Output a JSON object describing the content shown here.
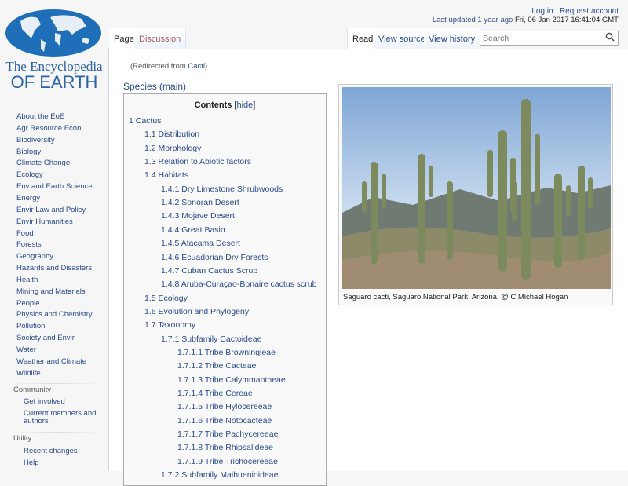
{
  "logo": {
    "line1": "The Encyclopedia",
    "line2": "OF EARTH"
  },
  "header": {
    "login": "Log in",
    "request_account": "Request account",
    "last_updated_label": "Last updated",
    "last_updated_rel": "1 year ago",
    "last_updated_date": "Fri, 06 Jan 2017 16:41:04 GMT"
  },
  "tabs": {
    "page": "Page",
    "discussion": "Discussion",
    "read": "Read",
    "view_source": "View source",
    "view_history": "View history"
  },
  "search": {
    "placeholder": "Search",
    "icon": "search-icon"
  },
  "sidebar": {
    "items": [
      "About the EoE",
      "Agr Resource Econ",
      "Biodiversity",
      "Biology",
      "Climate Change",
      "Ecology",
      "Env and Earth Science",
      "Energy",
      "Envir Law and Policy",
      "Envir Humanities",
      "Food",
      "Forests",
      "Geography",
      "Hazards and Disasters",
      "Health",
      "Mining and Materials",
      "People",
      "Physics and Chemistry",
      "Pollution",
      "Society and Envir",
      "Water",
      "Weather and Climate",
      "Wildlife"
    ],
    "community": {
      "heading": "Community",
      "items": [
        "Get involved",
        "Current members and",
        "authors"
      ]
    },
    "utility": {
      "heading": "Utility",
      "items": [
        "Recent changes",
        "Help"
      ]
    }
  },
  "main": {
    "redirect_prefix": "(Redirected from ",
    "redirect_link": "Cacti",
    "redirect_suffix": ")",
    "heading": "Species (main)"
  },
  "toc": {
    "title": "Contents",
    "hide_open": "[",
    "hide": "hide",
    "hide_close": "]",
    "items": [
      {
        "level": 1,
        "text": "1 Cactus"
      },
      {
        "level": 2,
        "text": "1.1 Distribution"
      },
      {
        "level": 2,
        "text": "1.2 Morphology"
      },
      {
        "level": 2,
        "text": "1.3 Relation to Abiotic factors"
      },
      {
        "level": 2,
        "text": "1.4 Habitats"
      },
      {
        "level": 3,
        "text": "1.4.1 Dry Limestone Shrubwoods"
      },
      {
        "level": 3,
        "text": "1.4.2 Sonoran Desert"
      },
      {
        "level": 3,
        "text": "1.4.3 Mojave Desert"
      },
      {
        "level": 3,
        "text": "1.4.4 Great Basin"
      },
      {
        "level": 3,
        "text": "1.4.5 Atacama Desert"
      },
      {
        "level": 3,
        "text": "1.4.6 Ecuadorian Dry Forests"
      },
      {
        "level": 3,
        "text": "1.4.7 Cuban Cactus Scrub"
      },
      {
        "level": 3,
        "text": "1.4.8 Aruba-Curaçao-Bonaire cactus scrub"
      },
      {
        "level": 2,
        "text": "1.5 Ecology"
      },
      {
        "level": 2,
        "text": "1.6 Evolution and Phylogeny"
      },
      {
        "level": 2,
        "text": "1.7 Taxonomy"
      },
      {
        "level": 3,
        "text": "1.7.1 Subfamily Cactoideae"
      },
      {
        "level": 4,
        "text": "1.7.1.1 Tribe Browningieae"
      },
      {
        "level": 4,
        "text": "1.7.1.2 Tribe Cacteae"
      },
      {
        "level": 4,
        "text": "1.7.1.3 Tribe Calymmantheae"
      },
      {
        "level": 4,
        "text": "1.7.1.4 Tribe Cereae"
      },
      {
        "level": 4,
        "text": "1.7.1.5 Tribe Hylocereeae"
      },
      {
        "level": 4,
        "text": "1.7.1.6 Tribe Notocacteae"
      },
      {
        "level": 4,
        "text": "1.7.1.7 Tribe Pachycereeae"
      },
      {
        "level": 4,
        "text": "1.7.1.8 Tribe Rhipsalideae"
      },
      {
        "level": 4,
        "text": "1.7.1.9 Tribe Trichocereeae"
      },
      {
        "level": 3,
        "text": "1.7.2 Subfamily Maihuenioideae"
      }
    ]
  },
  "figure": {
    "caption": "Saguaro cacti, Saguaro National Park, Arizona. @ C.Michael Hogan"
  }
}
